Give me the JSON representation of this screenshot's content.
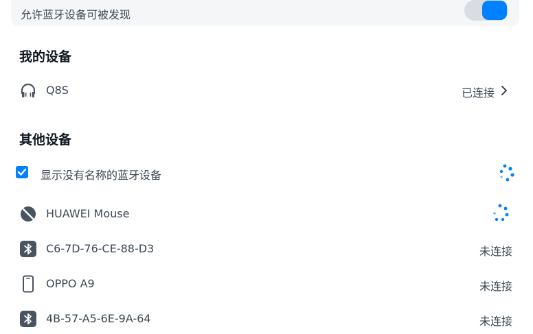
{
  "discover": {
    "label": "允许蓝牙设备可被发现",
    "enabled": true
  },
  "my_devices": {
    "title": "我的设备",
    "items": [
      {
        "name": "Q8S",
        "status": "已连接",
        "icon": "headphones-icon"
      }
    ]
  },
  "other_devices": {
    "title": "其他设备",
    "show_unnamed": {
      "label": "显示没有名称的蓝牙设备",
      "checked": true
    },
    "items": [
      {
        "name": "HUAWEI  Mouse",
        "status": "",
        "icon": "mouse-icon",
        "loading": true
      },
      {
        "name": "C6-7D-76-CE-88-D3",
        "status": "未连接",
        "icon": "bluetooth-icon"
      },
      {
        "name": "OPPO A9",
        "status": "未连接",
        "icon": "phone-icon"
      },
      {
        "name": "4B-57-A5-6E-9A-64",
        "status": "未连接",
        "icon": "bluetooth-icon"
      }
    ]
  },
  "colors": {
    "accent": "#0081ff",
    "text": "#3c4653",
    "icon": "#4a5360"
  }
}
